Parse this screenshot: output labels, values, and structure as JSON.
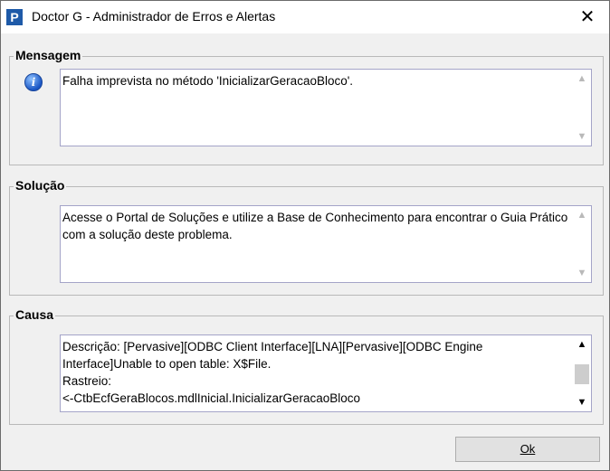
{
  "window": {
    "title": "Doctor G - Administrador de Erros e Alertas",
    "close_glyph": "✕",
    "app_icon_letter": "P"
  },
  "mensagem": {
    "label": "Mensagem",
    "icon": "info-icon",
    "text": "Falha imprevista no método 'InicializarGeracaoBloco'."
  },
  "solucao": {
    "label": "Solução",
    "text": "Acesse o Portal de Soluções e utilize a Base de Conhecimento para encontrar o Guia Prático com a solução deste problema."
  },
  "causa": {
    "label": "Causa",
    "line1": "Descrição: [Pervasive][ODBC Client Interface][LNA][Pervasive][ODBC Engine Interface]Unable to open table: X$File.",
    "line2": "Rastreio:",
    "line3": "<-CtbEcfGeraBlocos.mdlInicial.InicializarGeracaoBloco"
  },
  "ok_button": {
    "label": "Ok"
  },
  "colors": {
    "accent": "#1e5aa8",
    "background": "#f0f0f0"
  }
}
